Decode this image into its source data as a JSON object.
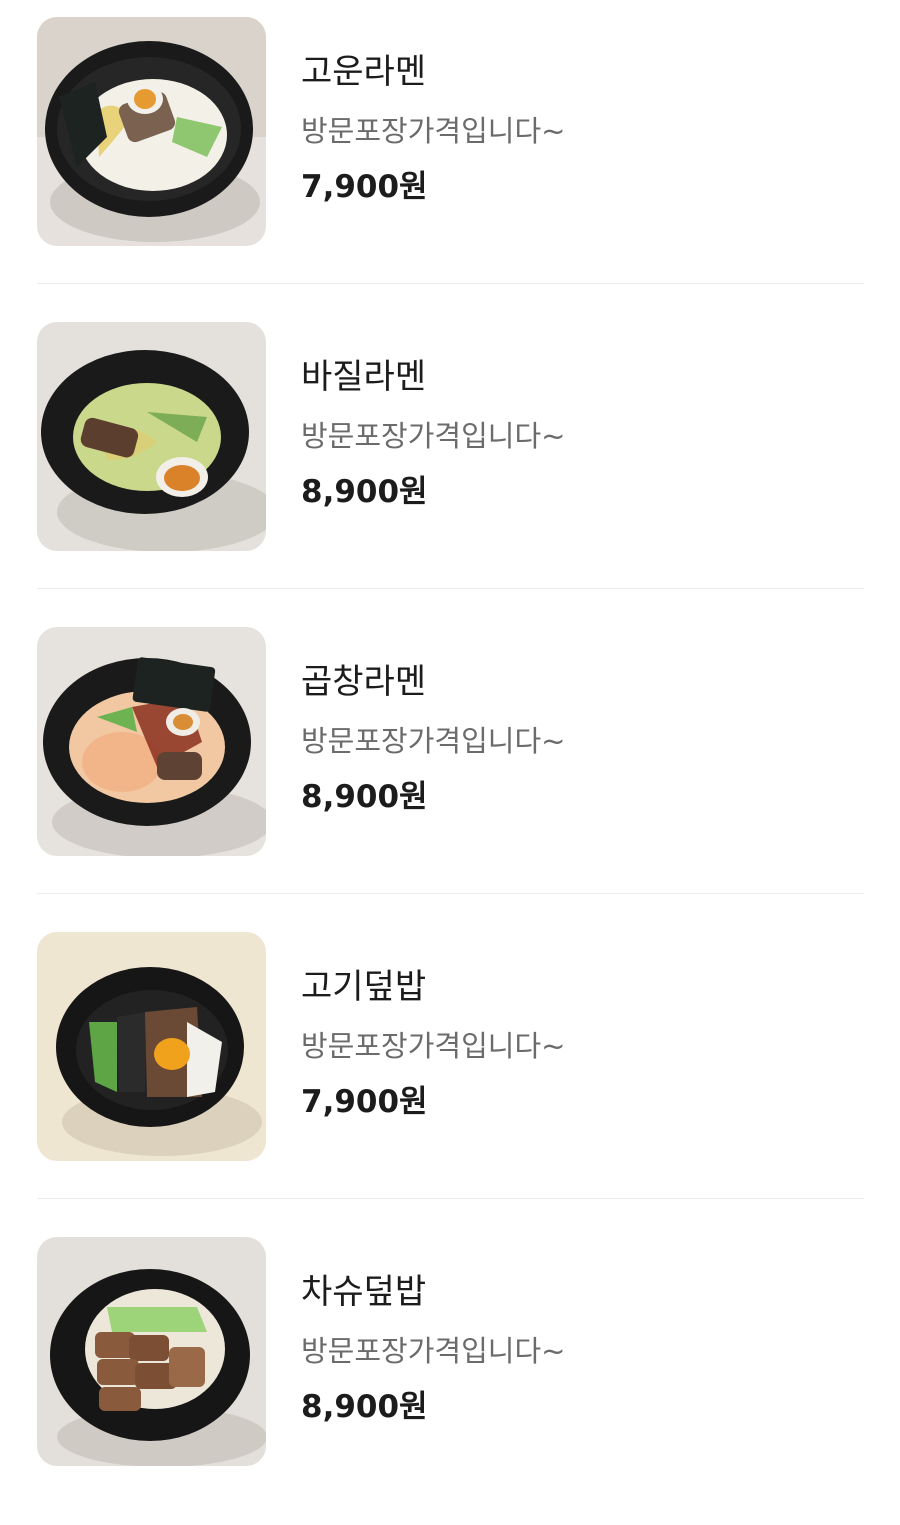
{
  "menu": {
    "items": [
      {
        "name": "고운라멘",
        "description": "방문포장가격입니다~",
        "price": "7,900원",
        "photo_icon": "ramen-bowl-photo"
      },
      {
        "name": "바질라멘",
        "description": "방문포장가격입니다~",
        "price": "8,900원",
        "photo_icon": "ramen-bowl-photo"
      },
      {
        "name": "곱창라멘",
        "description": "방문포장가격입니다~",
        "price": "8,900원",
        "photo_icon": "ramen-bowl-photo"
      },
      {
        "name": "고기덮밥",
        "description": "방문포장가격입니다~",
        "price": "7,900원",
        "photo_icon": "rice-bowl-photo"
      },
      {
        "name": "차슈덮밥",
        "description": "방문포장가격입니다~",
        "price": "8,900원",
        "photo_icon": "rice-bowl-photo"
      }
    ]
  }
}
